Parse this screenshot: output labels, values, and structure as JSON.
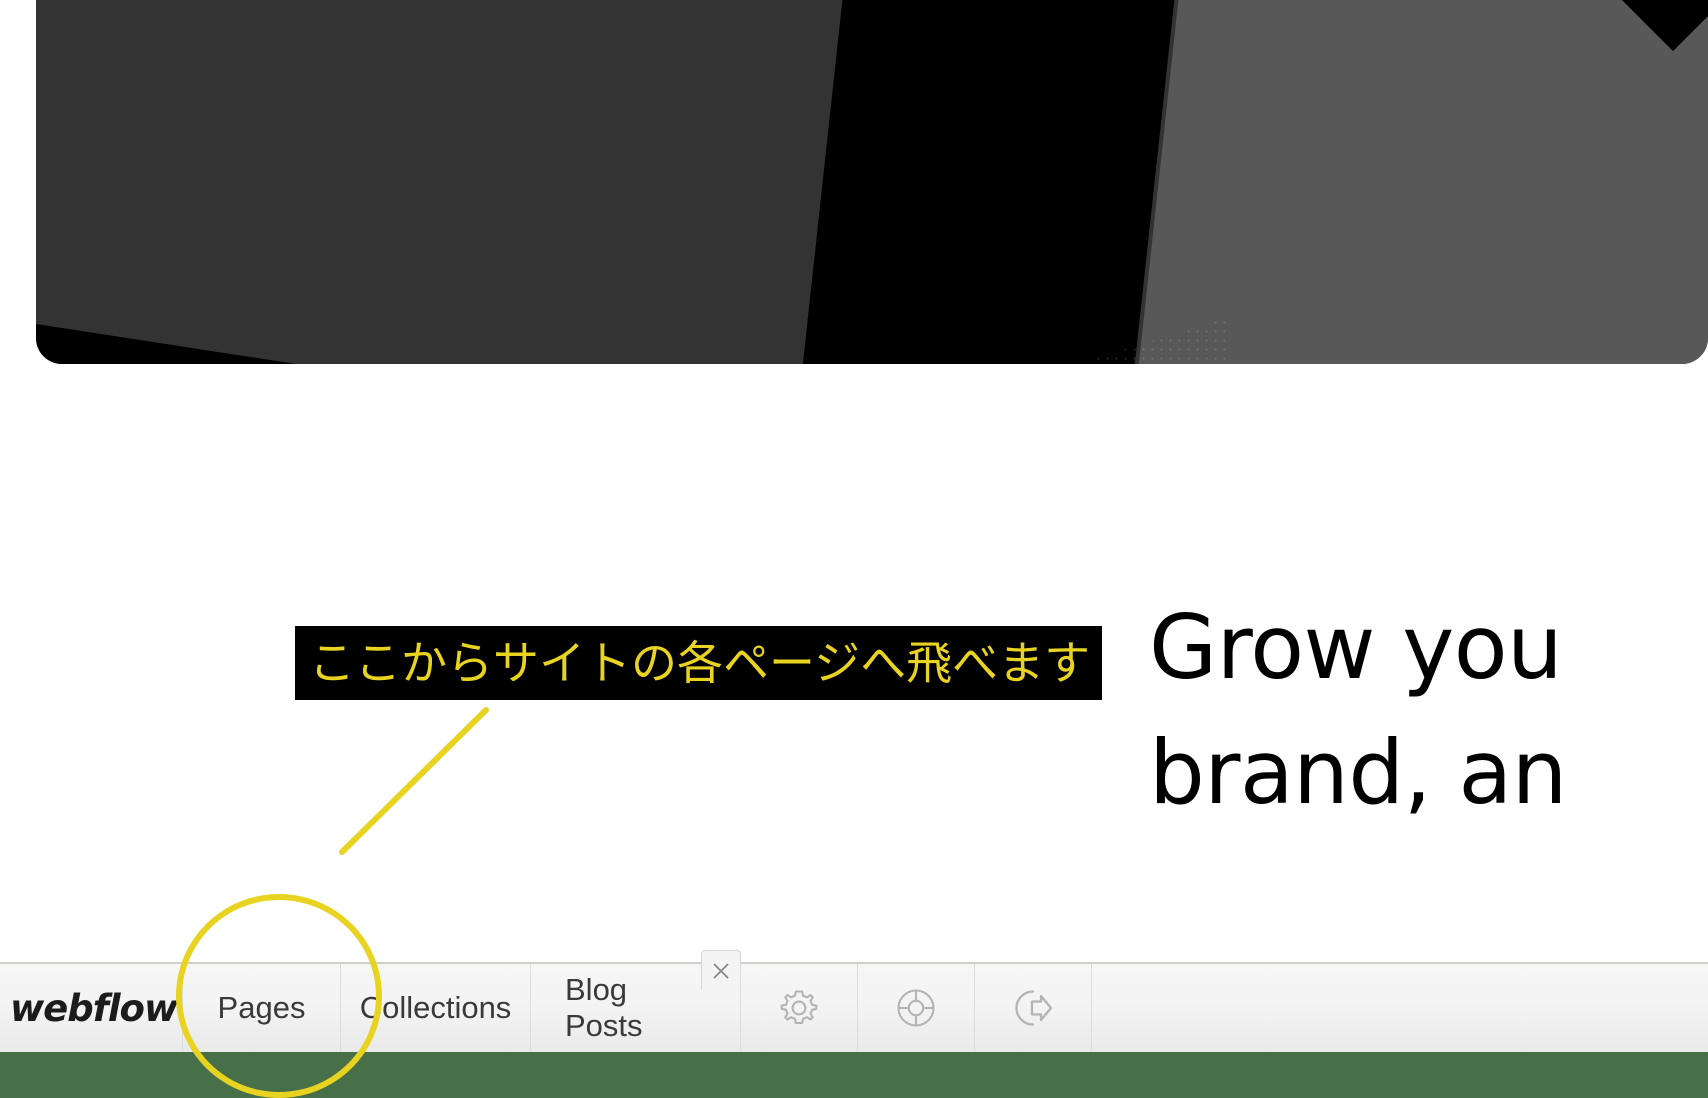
{
  "hero": {
    "name": "hero-banner-image",
    "colors": {
      "panel": "#333333",
      "band_black": "#000000",
      "band_gray": "#585858"
    }
  },
  "headline": {
    "line1": "Grow you",
    "line2": "brand, an"
  },
  "annotation": {
    "label_text": "ここからサイトの各ページへ飛べます",
    "label_bg": "#000000",
    "label_color": "#E8D321",
    "marker_color": "#E8D321",
    "target": "Pages"
  },
  "toolbar": {
    "logo_text": "webflow",
    "tabs": [
      {
        "label": "Pages"
      },
      {
        "label": "Collections"
      },
      {
        "label": "Blog Posts"
      }
    ],
    "close_label": "×",
    "icons": [
      {
        "name": "settings-gear-icon",
        "label": "Settings"
      },
      {
        "name": "lifebuoy-help-icon",
        "label": "Help"
      },
      {
        "name": "logout-icon",
        "label": "Log out"
      }
    ]
  },
  "desktop": {
    "strip_color": "#477049"
  }
}
